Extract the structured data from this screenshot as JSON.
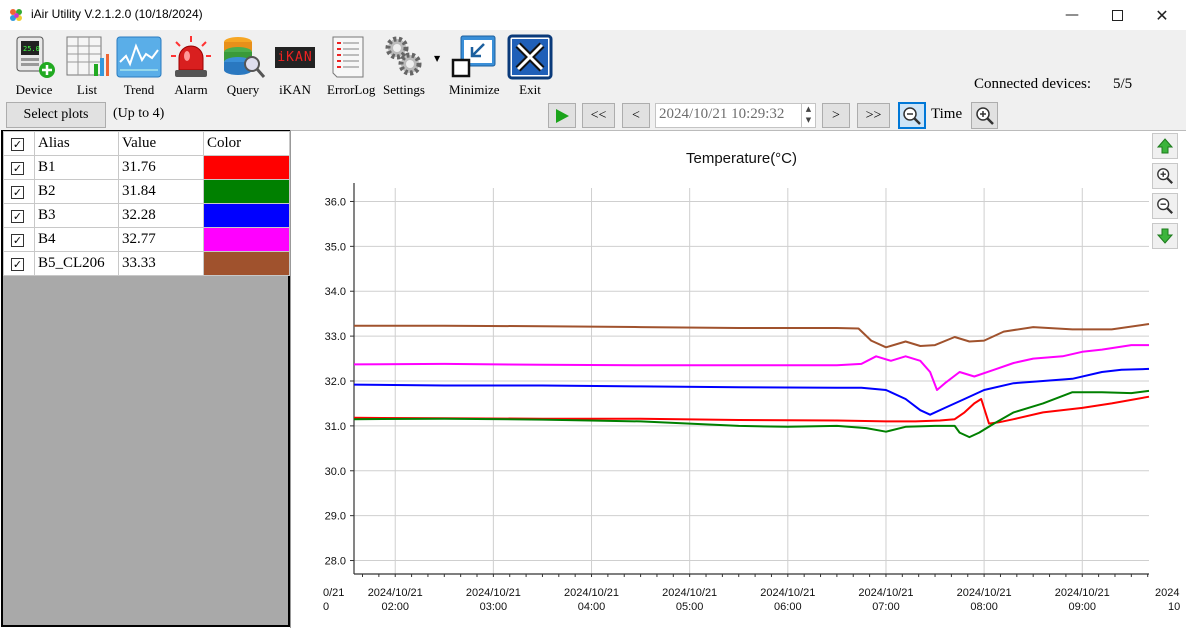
{
  "window": {
    "title": "iAir Utility V.2.1.2.0 (10/18/2024)"
  },
  "toolbar": {
    "items": [
      {
        "label": "Device",
        "icon": "device-add-icon"
      },
      {
        "label": "List",
        "icon": "list-icon"
      },
      {
        "label": "Trend",
        "icon": "trend-icon"
      },
      {
        "label": "Alarm",
        "icon": "alarm-icon"
      },
      {
        "label": "Query",
        "icon": "query-icon"
      },
      {
        "label": "iKAN",
        "icon": "ikan-icon"
      },
      {
        "label": "ErrorLog",
        "icon": "errorlog-icon"
      },
      {
        "label": "Settings",
        "icon": "gear-icon"
      },
      {
        "label": "Minimize",
        "icon": "minimize-window-icon"
      },
      {
        "label": "Exit",
        "icon": "exit-icon"
      }
    ],
    "ikan_text": "iKAN",
    "connected_label": "Connected devices:",
    "connected_count": "5/5"
  },
  "nav": {
    "select_plots": "Select plots",
    "up_to": "(Up to 4)",
    "first": "<<",
    "prev": "<",
    "datetime": "2024/10/21 10:29:32",
    "next": ">",
    "last": ">>",
    "time_label": "Time"
  },
  "table": {
    "headers": [
      "Alias",
      "Value",
      "Color"
    ],
    "rows": [
      {
        "alias": "B1",
        "value": "31.76",
        "color": "#ff0000"
      },
      {
        "alias": "B2",
        "value": "31.84",
        "color": "#008000"
      },
      {
        "alias": "B3",
        "value": "32.28",
        "color": "#0000ff"
      },
      {
        "alias": "B4",
        "value": "32.77",
        "color": "#ff00ff"
      },
      {
        "alias": "B5_CL206",
        "value": "33.33",
        "color": "#a0522d"
      }
    ]
  },
  "chart_data": {
    "type": "line",
    "title": "Temperature(°C)",
    "ylim": [
      27.7,
      36.3
    ],
    "y_ticks": [
      "28.0",
      "29.0",
      "30.0",
      "31.0",
      "32.0",
      "33.0",
      "34.0",
      "35.0",
      "36.0"
    ],
    "x_ticks": [
      {
        "date": "2024/10/21",
        "time": "02:00",
        "h": 2
      },
      {
        "date": "2024/10/21",
        "time": "03:00",
        "h": 3
      },
      {
        "date": "2024/10/21",
        "time": "04:00",
        "h": 4
      },
      {
        "date": "2024/10/21",
        "time": "05:00",
        "h": 5
      },
      {
        "date": "2024/10/21",
        "time": "06:00",
        "h": 6
      },
      {
        "date": "2024/10/21",
        "time": "07:00",
        "h": 7
      },
      {
        "date": "2024/10/21",
        "time": "08:00",
        "h": 8
      },
      {
        "date": "2024/10/21",
        "time": "09:00",
        "h": 9
      }
    ],
    "edge_labels": {
      "left_top": "0/21",
      "left_bottom": "0",
      "right_top": "2024",
      "right_bottom": "10"
    },
    "xlim_hours": [
      1.58,
      9.68
    ],
    "grid": true,
    "series": [
      {
        "name": "B1",
        "color": "#ff0000",
        "x": [
          1.58,
          2.5,
          3.5,
          4.5,
          5.5,
          6.5,
          7.0,
          7.3,
          7.55,
          7.7,
          7.8,
          7.9,
          7.97,
          8.05,
          8.15,
          8.3,
          8.6,
          9.0,
          9.3,
          9.68
        ],
        "y": [
          31.18,
          31.17,
          31.16,
          31.16,
          31.13,
          31.12,
          31.1,
          31.1,
          31.12,
          31.15,
          31.3,
          31.5,
          31.6,
          31.05,
          31.08,
          31.15,
          31.3,
          31.4,
          31.5,
          31.65
        ]
      },
      {
        "name": "B2",
        "color": "#008000",
        "x": [
          1.58,
          2.5,
          3.5,
          4.5,
          5.5,
          6.0,
          6.5,
          6.8,
          7.0,
          7.2,
          7.5,
          7.7,
          7.75,
          7.85,
          7.95,
          8.1,
          8.3,
          8.6,
          8.9,
          9.2,
          9.5,
          9.68
        ],
        "y": [
          31.15,
          31.16,
          31.14,
          31.1,
          31.0,
          30.98,
          31.0,
          30.95,
          30.87,
          30.98,
          31.0,
          31.0,
          30.85,
          30.75,
          30.85,
          31.05,
          31.3,
          31.5,
          31.75,
          31.75,
          31.73,
          31.78
        ]
      },
      {
        "name": "B3",
        "color": "#0000ff",
        "x": [
          1.58,
          2.5,
          3.5,
          4.5,
          5.5,
          6.5,
          6.75,
          7.0,
          7.2,
          7.35,
          7.45,
          7.6,
          7.8,
          8.0,
          8.3,
          8.6,
          8.9,
          9.2,
          9.4,
          9.68
        ],
        "y": [
          31.92,
          31.9,
          31.9,
          31.88,
          31.86,
          31.85,
          31.85,
          31.8,
          31.6,
          31.35,
          31.25,
          31.4,
          31.6,
          31.8,
          31.95,
          32.0,
          32.05,
          32.2,
          32.25,
          32.27
        ]
      },
      {
        "name": "B4",
        "color": "#ff00ff",
        "x": [
          1.58,
          2.5,
          3.5,
          4.5,
          5.5,
          6.5,
          6.75,
          6.9,
          7.05,
          7.2,
          7.35,
          7.45,
          7.52,
          7.6,
          7.75,
          7.9,
          8.1,
          8.3,
          8.5,
          8.8,
          9.0,
          9.2,
          9.5,
          9.68
        ],
        "y": [
          32.37,
          32.38,
          32.36,
          32.35,
          32.35,
          32.35,
          32.38,
          32.55,
          32.45,
          32.55,
          32.45,
          32.2,
          31.8,
          31.95,
          32.2,
          32.1,
          32.25,
          32.4,
          32.5,
          32.55,
          32.65,
          32.7,
          32.8,
          32.8
        ]
      },
      {
        "name": "B5_CL206",
        "color": "#a0522d",
        "x": [
          1.58,
          2.5,
          3.5,
          4.5,
          5.5,
          6.5,
          6.72,
          6.85,
          7.0,
          7.2,
          7.35,
          7.5,
          7.7,
          7.85,
          8.0,
          8.2,
          8.5,
          8.9,
          9.3,
          9.68
        ],
        "y": [
          33.23,
          33.23,
          33.22,
          33.2,
          33.18,
          33.18,
          33.17,
          32.9,
          32.75,
          32.88,
          32.78,
          32.8,
          32.98,
          32.88,
          32.9,
          33.1,
          33.2,
          33.15,
          33.15,
          33.27
        ]
      }
    ]
  }
}
